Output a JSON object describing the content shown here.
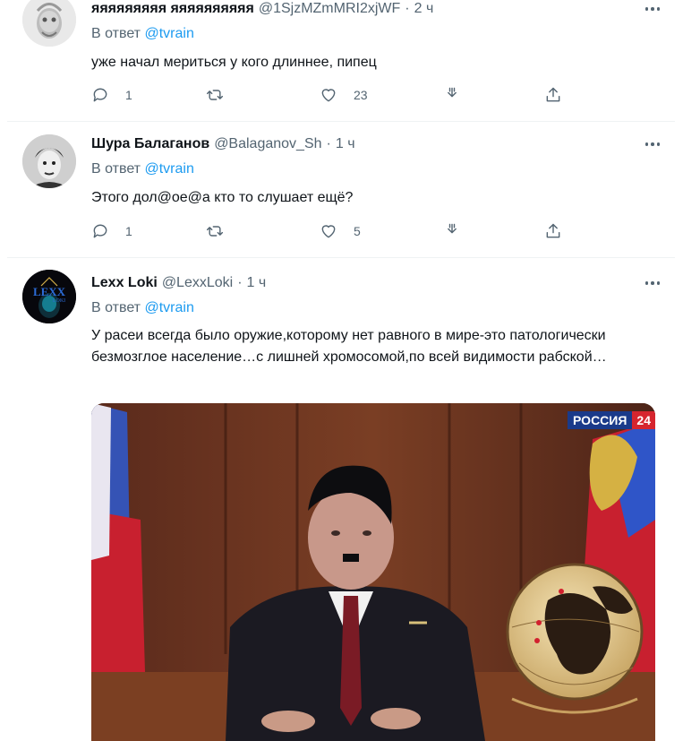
{
  "tweets": [
    {
      "name": "яяяяяяяяя яяяяяяяяяя",
      "handle": "@1SjzMZmMRI2xjWF",
      "time": "2 ч",
      "reply_prefix": "В ответ",
      "reply_to": "@tvrain",
      "text": "уже начал мериться у кого длиннее, пипец",
      "replies": "1",
      "retweets": "",
      "likes": "23"
    },
    {
      "name": "Шура Балаганов",
      "handle": "@Balaganov_Sh",
      "time": "1 ч",
      "reply_prefix": "В ответ",
      "reply_to": "@tvrain",
      "text": "Этого дол@ое@а кто то слушает ещё?",
      "replies": "1",
      "retweets": "",
      "likes": "5"
    },
    {
      "name": "Lexx Loki",
      "handle": "@LexxLoki",
      "time": "1 ч",
      "reply_prefix": "В ответ",
      "reply_to": "@tvrain",
      "text": "У расеи всегда было оружие,которому нет равного в мире-это патологически безмозглое население…с лишней хромосомой,по всей видимости рабской…",
      "media_badge_channel": "РОССИЯ",
      "media_badge_number": "24",
      "avatar_logo": "LEXX LOKI"
    }
  ],
  "dot": "·",
  "icons": [
    "reply-icon",
    "retweet-icon",
    "like-icon",
    "download-icon",
    "share-icon",
    "more-icon"
  ],
  "colors": {
    "mention": "#1d9bf0",
    "secondary": "#536471",
    "text": "#0f1419",
    "divider": "#eff3f4"
  }
}
